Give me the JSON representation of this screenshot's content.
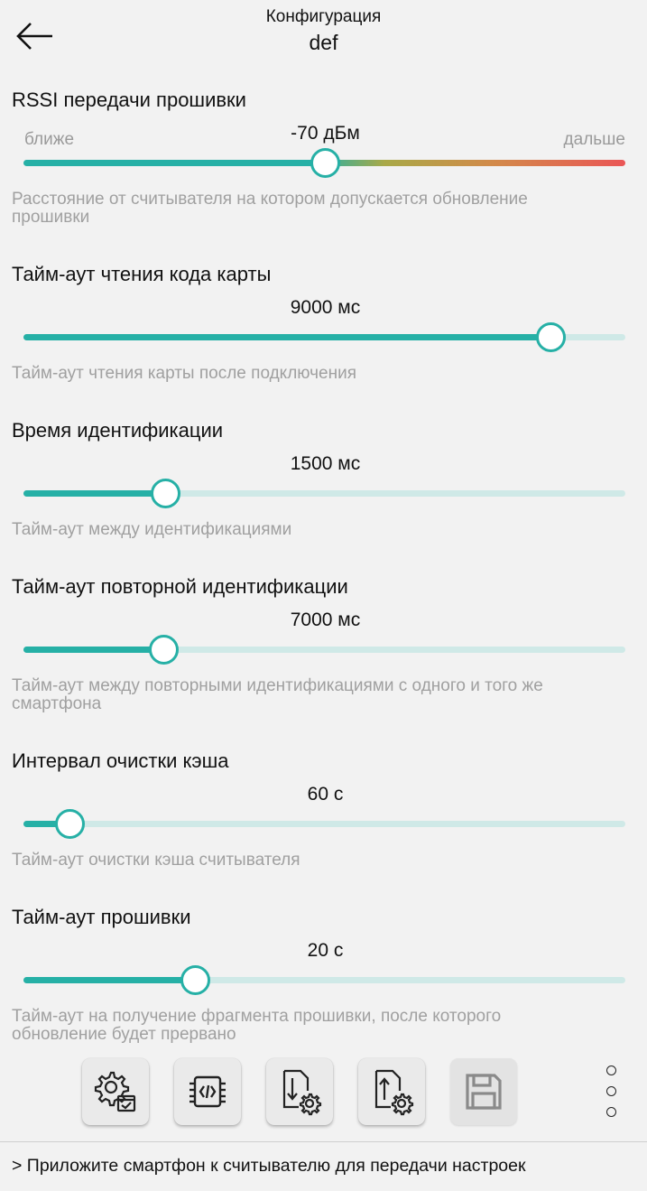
{
  "header": {
    "title": "Конфигурация",
    "subtitle": "def"
  },
  "settings": [
    {
      "title": "RSSI передачи прошивки",
      "value": "-70 дБм",
      "hint_left": "ближе",
      "hint_right": "дальше",
      "fraction": 0.5,
      "description_line1": "Расстояние от считывателя на котором допускается обновление",
      "description_line2": "прошивки"
    },
    {
      "title": "Тайм-аут чтения кода карты",
      "value": "9000 мс",
      "fraction": 0.875,
      "description_line1": "Тайм-аут чтения карты после подключения",
      "description_line2": ""
    },
    {
      "title": "Время идентификации",
      "value": "1500 мс",
      "fraction": 0.236,
      "description_line1": "Тайм-аут между идентификациями",
      "description_line2": ""
    },
    {
      "title": "Тайм-аут повторной идентификации",
      "value": "7000 мс",
      "fraction": 0.233,
      "description_line1": "Тайм-аут между повторными идентификациями с одного и того же",
      "description_line2": "смартфона"
    },
    {
      "title": "Интервал очистки кэша",
      "value": "60 с",
      "fraction": 0.076,
      "description_line1": "Тайм-аут очистки кэша считывателя",
      "description_line2": ""
    },
    {
      "title": "Тайм-аут прошивки",
      "value": "20 с",
      "fraction": 0.285,
      "description_line1": "Тайм-аут на получение фрагмента прошивки, после которого",
      "description_line2": "обновление будет прервано"
    }
  ],
  "toolbar": {
    "buttons": [
      "settings-check-icon",
      "chip-code-icon",
      "download-settings-icon",
      "upload-settings-icon",
      "save-icon"
    ]
  },
  "status": {
    "text": "> Приложите смартфон к считывателю для передачи настроек"
  },
  "colors": {
    "accent": "#26b0a6",
    "track_inactive": "#cfe9e7",
    "gradient_end": "#ea5656",
    "hint_text": "#a0a0a0"
  }
}
